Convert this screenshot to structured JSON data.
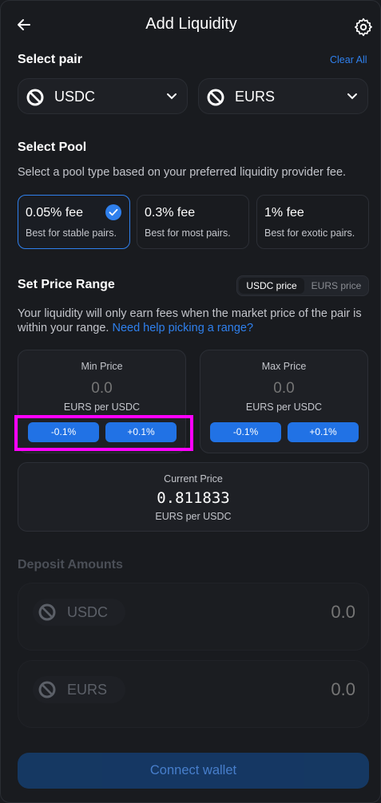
{
  "header": {
    "title": "Add Liquidity"
  },
  "select_pair": {
    "title": "Select pair",
    "clear_all": "Clear All",
    "token_a": "USDC",
    "token_b": "EURS"
  },
  "select_pool": {
    "title": "Select Pool",
    "description": "Select a pool type based on your preferred liquidity provider fee.",
    "options": [
      {
        "label": "0.05% fee",
        "sub": "Best for stable pairs.",
        "selected": true
      },
      {
        "label": "0.3% fee",
        "sub": "Best for most pairs.",
        "selected": false
      },
      {
        "label": "1% fee",
        "sub": "Best for exotic pairs.",
        "selected": false
      }
    ]
  },
  "price_range": {
    "title": "Set Price Range",
    "toggle_active": "USDC price",
    "toggle_inactive": "EURS price",
    "description": "Your liquidity will only earn fees when the market price of the pair is within your range.",
    "help_link": "Need help picking a range?",
    "min": {
      "title": "Min Price",
      "placeholder": "0.0",
      "unit": "EURS per USDC",
      "dec": "-0.1%",
      "inc": "+0.1%"
    },
    "max": {
      "title": "Max Price",
      "placeholder": "0.0",
      "unit": "EURS per USDC",
      "dec": "-0.1%",
      "inc": "+0.1%"
    },
    "current": {
      "title": "Current Price",
      "value": "0.811833",
      "unit": "EURS per USDC"
    }
  },
  "deposit": {
    "title": "Deposit Amounts",
    "token_a": {
      "name": "USDC",
      "placeholder": "0.0"
    },
    "token_b": {
      "name": "EURS",
      "placeholder": "0.0"
    }
  },
  "connect_button": "Connect wallet",
  "colors": {
    "accent": "#2f80ed",
    "button_blue": "#2172e5",
    "highlight": "#ff00ff",
    "background": "#191b1f"
  }
}
